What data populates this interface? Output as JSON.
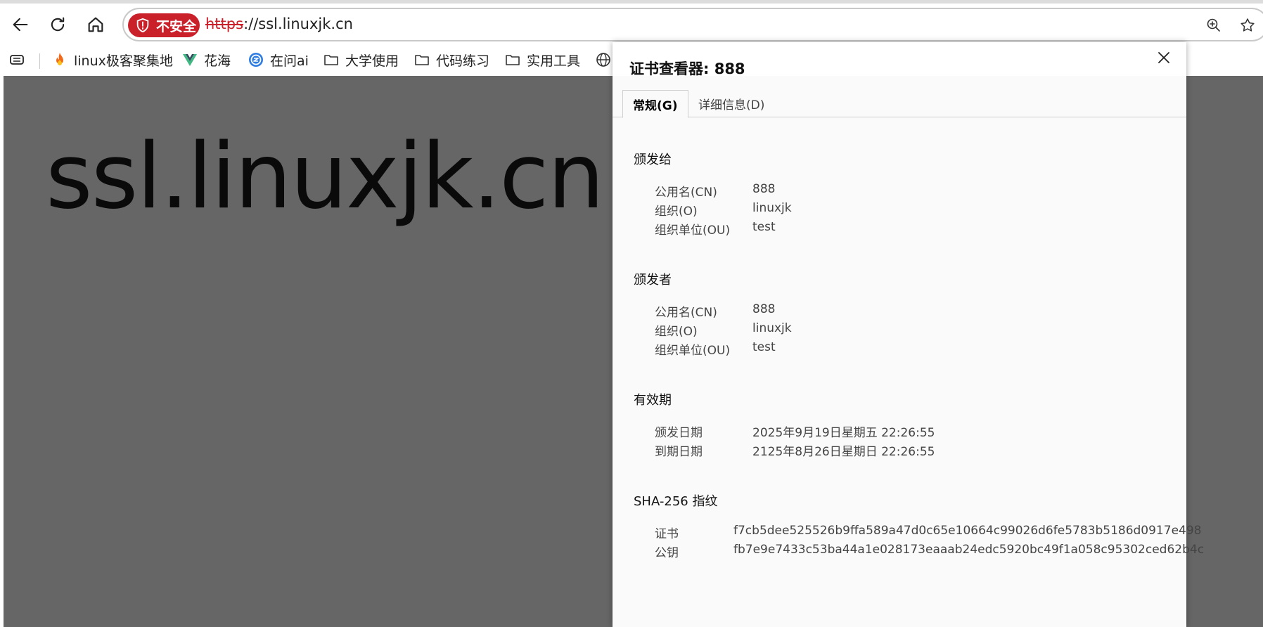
{
  "browser": {
    "security_badge": "不安全",
    "url_scheme": "https",
    "url_rest": "://ssl.linuxjk.cn"
  },
  "bookmarks": [
    {
      "label": "linux极客聚集地",
      "icon": "fire-icon"
    },
    {
      "label": "花海",
      "icon": "vue-logo-icon"
    },
    {
      "label": "在问ai",
      "icon": "ai-logo-icon"
    },
    {
      "label": "大学使用",
      "icon": "folder-icon"
    },
    {
      "label": "代码练习",
      "icon": "folder-icon"
    },
    {
      "label": "实用工具",
      "icon": "folder-icon"
    }
  ],
  "page": {
    "heading": "ssl.linuxjk.cn"
  },
  "dialog": {
    "title": "证书查看器: 888",
    "tabs": [
      {
        "label": "常规(G)",
        "active": true
      },
      {
        "label": "详细信息(D)",
        "active": false
      }
    ],
    "issued_to": {
      "title": "颁发给",
      "rows": [
        {
          "label": "公用名(CN)",
          "value": "888"
        },
        {
          "label": "组织(O)",
          "value": "linuxjk"
        },
        {
          "label": "组织单位(OU)",
          "value": "test"
        }
      ]
    },
    "issued_by": {
      "title": "颁发者",
      "rows": [
        {
          "label": "公用名(CN)",
          "value": "888"
        },
        {
          "label": "组织(O)",
          "value": "linuxjk"
        },
        {
          "label": "组织单位(OU)",
          "value": "test"
        }
      ]
    },
    "validity": {
      "title": "有效期",
      "rows": [
        {
          "label": "颁发日期",
          "value": "2025年9月19日星期五 22:26:55"
        },
        {
          "label": "到期日期",
          "value": "2125年8月26日星期日 22:26:55"
        }
      ]
    },
    "fingerprints": {
      "title": "SHA-256 指纹",
      "rows": [
        {
          "label": "证书",
          "value": "f7cb5dee525526b9ffa589a47d0c65e10664c99026d6fe5783b5186d0917e498"
        },
        {
          "label": "公钥",
          "value": "fb7e9e7433c53ba44a1e028173eaaab24edc5920bc49f1a058c95302ced62b4c"
        }
      ]
    }
  },
  "colors": {
    "insecure_red": "#c9202a",
    "page_gray": "#666666",
    "dialog_bg": "#fafafa"
  }
}
